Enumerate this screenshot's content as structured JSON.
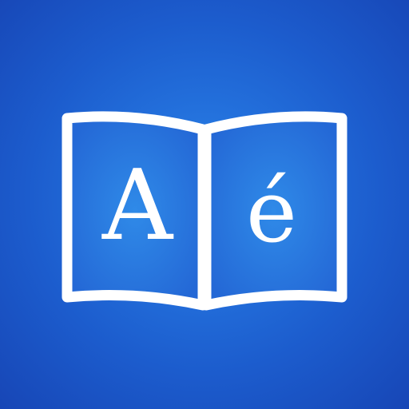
{
  "app_icon": {
    "left_page_letter": "A",
    "right_page_letter": "é",
    "colors": {
      "background_center": "#2b86e6",
      "background_edge": "#1746b6",
      "page_fill": "#2a7de2",
      "outline": "#ffffff"
    },
    "icon_name": "open-book-icon"
  }
}
